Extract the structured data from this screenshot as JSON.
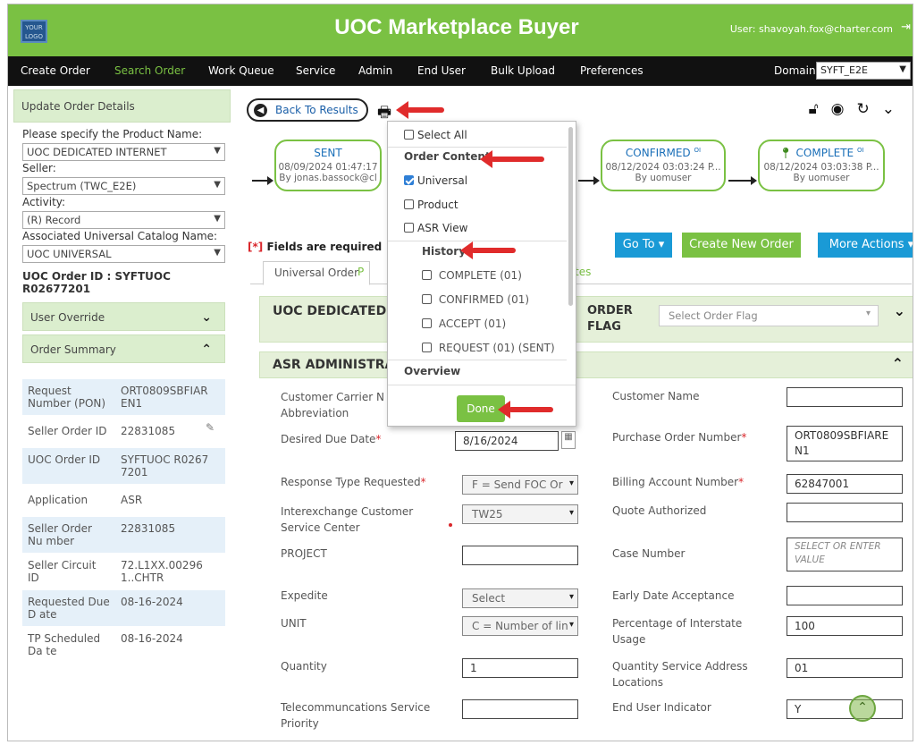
{
  "header": {
    "logo_text": "YOUR LOGO",
    "title": "UOC Marketplace Buyer",
    "user": "User: shavoyah.fox@charter.com",
    "logout_icon": "logout-icon"
  },
  "nav": {
    "items": [
      "Create Order",
      "Search Order",
      "Work Queue",
      "Service",
      "Admin",
      "End User",
      "Bulk Upload",
      "Preferences"
    ],
    "active": "Search Order",
    "domain_label": "Domain:",
    "domain_value": "SYFT_E2E"
  },
  "left": {
    "update_header": "Update Order Details",
    "product_label": "Please specify the Product Name:",
    "product_value": "UOC DEDICATED INTERNET",
    "seller_label": "Seller:",
    "seller_value": "Spectrum (TWC_E2E)",
    "activity_label": "Activity:",
    "activity_value": "(R) Record",
    "catalog_label": "Associated Universal Catalog Name:",
    "catalog_value": "UOC UNIVERSAL",
    "order_id": "UOC Order ID : SYFTUOC R02677201",
    "user_override": "User Override",
    "order_summary": "Order Summary",
    "summary": [
      {
        "k": "Request Number (PON)",
        "v": "ORT0809SBFIAR EN1"
      },
      {
        "k": "Seller Order ID",
        "v": "22831085"
      },
      {
        "k": "UOC Order ID",
        "v": "SYFTUOC R0267 7201"
      },
      {
        "k": "Application",
        "v": "ASR"
      },
      {
        "k": "Seller Order Nu mber",
        "v": "22831085"
      },
      {
        "k": "Seller Circuit ID",
        "v": "72.L1XX.00296 1..CHTR"
      },
      {
        "k": "Requested Due D ate",
        "v": "08-16-2024"
      },
      {
        "k": "TP Scheduled Da te",
        "v": "08-16-2024"
      }
    ]
  },
  "toolbar": {
    "back": "Back To Results"
  },
  "workflow": {
    "sent": {
      "t": "SENT",
      "d": "08/09/2024 01:47:17",
      "b": "By jonas.bassock@cl"
    },
    "confirmed": {
      "t": "CONFIRMED",
      "sup": "OI",
      "d": "08/12/2024 03:03:24 P...",
      "b": "By uomuser"
    },
    "complete": {
      "t": "COMPLETE",
      "sup": "OI",
      "d": "08/12/2024 03:03:38 P...",
      "b": "By uomuser"
    }
  },
  "actions": {
    "required": "Fields are required",
    "required_mark": "[*]",
    "goto": "Go To",
    "create": "Create New Order",
    "more": "More Actions"
  },
  "tabs": {
    "universal": "Universal Order",
    "p_fragment": "P",
    "tes_fragment": "tes"
  },
  "section1": {
    "title": "UOC DEDICATED I",
    "flag_label": "ORDER FLAG",
    "flag_placeholder": "Select Order Flag"
  },
  "section2": {
    "title": "ASR ADMINISTRAT"
  },
  "dropdown": {
    "select_all": "Select All",
    "order_content": "Order Content",
    "universal": "Universal",
    "product": "Product",
    "asr_view": "ASR View",
    "history": "History",
    "h1": "COMPLETE (01)",
    "h2": "CONFIRMED (01)",
    "h3": "ACCEPT (01)",
    "h4": "REQUEST (01) (SENT)",
    "overview": "Overview",
    "done": "Done"
  },
  "form": {
    "cc_abbrev": "Customer Carrier N Abbreviation",
    "desired_due": "Desired Due Date",
    "desired_due_val": "8/16/2024",
    "response_type": "Response Type Requested",
    "response_type_val": "F = Send FOC Or",
    "icsc": "Interexchange Customer Service Center",
    "icsc_val": "TW25",
    "project": "PROJECT",
    "expedite": "Expedite",
    "expedite_val": "Select",
    "unit": "UNIT",
    "unit_val": "C = Number of lin",
    "quantity": "Quantity",
    "quantity_val": "1",
    "tsp": "Telecommuncations Service Priority",
    "customer_name": "Customer Name",
    "po_number": "Purchase Order Number",
    "po_val": "ORT0809SBFIARE N1",
    "ban": "Billing Account Number",
    "ban_val": "62847001",
    "quote": "Quote Authorized",
    "case": "Case Number",
    "case_placeholder": "SELECT OR ENTER VALUE",
    "early": "Early Date Acceptance",
    "piu": "Percentage of Interstate Usage",
    "piu_val": "100",
    "qsal": "Quantity Service Address Locations",
    "qsal_val": "01",
    "eui": "End User Indicator",
    "eui_val": "Y"
  },
  "colors": {
    "brand_green": "#7ac143",
    "nav_black": "#111111",
    "blue_btn": "#1a9ad6",
    "arrow_red": "#e02b2b"
  }
}
